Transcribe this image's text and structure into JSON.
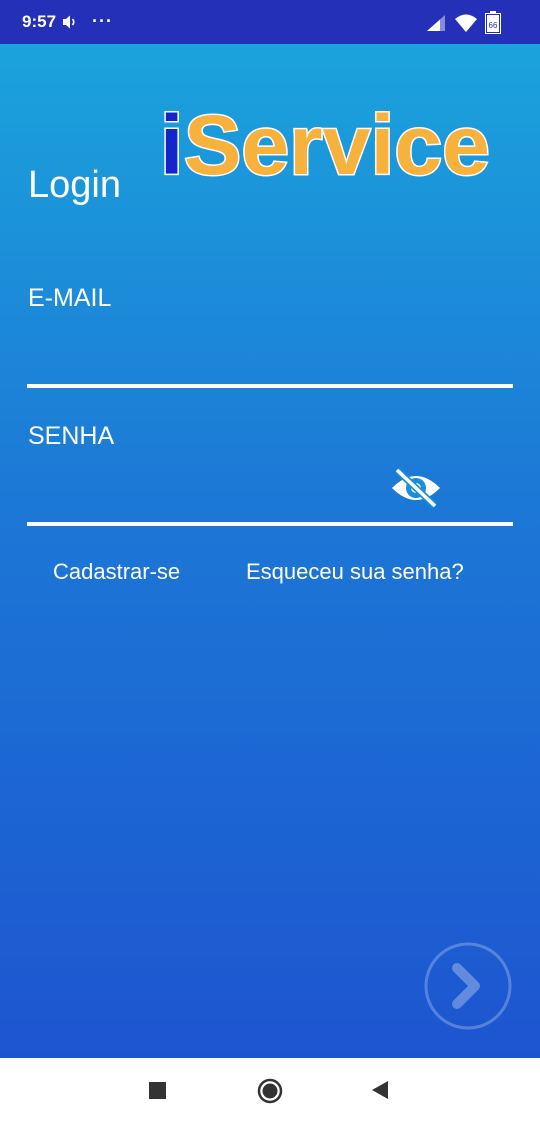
{
  "status_bar": {
    "time": "9:57",
    "more": "···",
    "battery_level": "66",
    "icons": [
      "volume-icon",
      "more-dots-icon",
      "signal-icon",
      "wifi-icon",
      "battery-icon"
    ]
  },
  "brand": {
    "prefix": "i",
    "name": "Service",
    "prefix_color": "#1426c8",
    "name_color": "#f7b13d",
    "outline_color": "#ffffff"
  },
  "login": {
    "title": "Login",
    "email_label": "E-MAIL",
    "email_value": "",
    "password_label": "SENHA",
    "password_value": "",
    "password_visibility_icon": "eye-off-icon",
    "register_link": "Cadastrar-se",
    "forgot_link": "Esqueceu sua senha?",
    "submit_icon": "chevron-right-icon"
  },
  "nav": {
    "icons": [
      "recent-apps-icon",
      "home-icon",
      "back-icon"
    ]
  },
  "colors": {
    "status_bar": "#2430b8",
    "gradient_top": "#1ba3dc",
    "gradient_bottom": "#1d55d0",
    "text": "#ffffff"
  }
}
